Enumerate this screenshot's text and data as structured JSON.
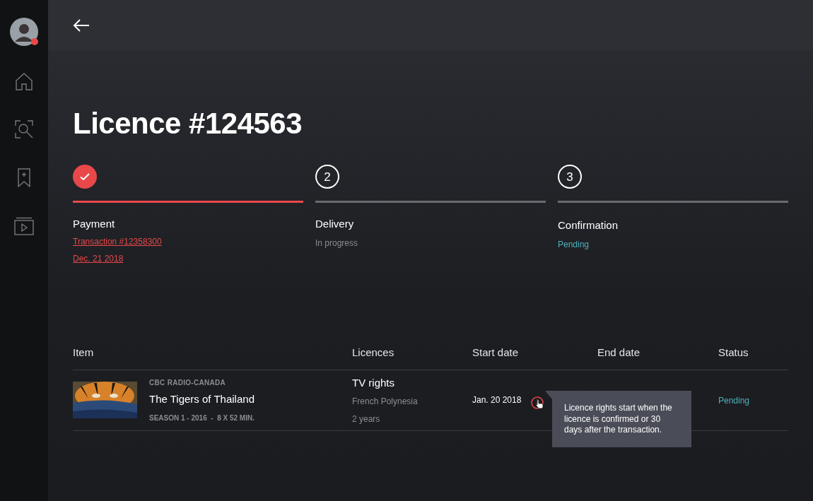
{
  "title": "Licence #124563",
  "steps": [
    {
      "kind": "done",
      "label": "Payment",
      "links": [
        "Transaction #12358300",
        "Dec. 21 2018"
      ]
    },
    {
      "kind": "current",
      "number": "2",
      "label": "Delivery",
      "detail": "In progress"
    },
    {
      "kind": "pending",
      "number": "3",
      "label": "Confirmation",
      "detail": "Pending"
    }
  ],
  "table": {
    "columns": [
      "Item",
      "Licences",
      "Start date",
      "End date",
      "Status"
    ],
    "rows": [
      {
        "channel": "CBC RADIO-CANADA",
        "title": "The Tigers of Thailand",
        "meta": "SEASON 1 - 2016  -  8 X 52 MIN.",
        "licence": "TV rights",
        "region": "French Polynesia",
        "duration": "2 years",
        "start_date": "Jan. 20 2018",
        "status": "Pending"
      }
    ]
  },
  "tooltip": {
    "text": "Licence rights start when the licence is confirmed or 30 days after the transaction."
  }
}
